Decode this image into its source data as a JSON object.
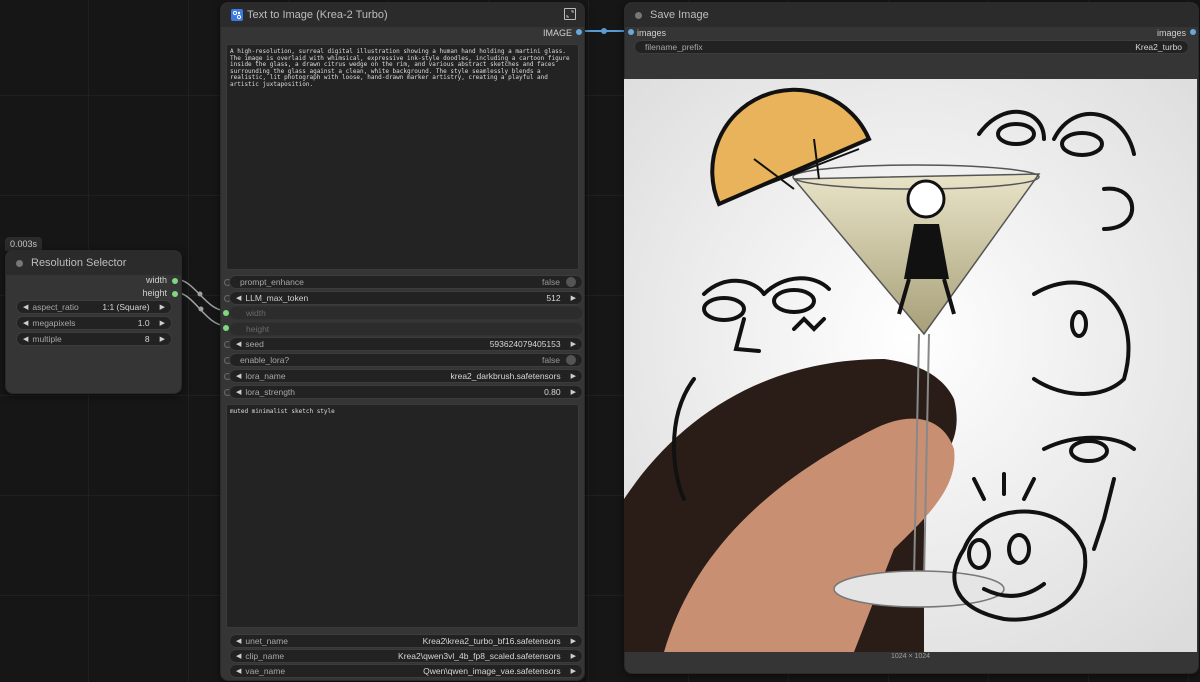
{
  "resolution_node": {
    "timing": "0.003s",
    "title": "Resolution Selector",
    "outputs": [
      "width",
      "height"
    ],
    "widgets": [
      {
        "label": "aspect_ratio",
        "value": "1:1 (Square)"
      },
      {
        "label": "megapixels",
        "value": "1.0"
      },
      {
        "label": "multiple",
        "value": "8"
      }
    ]
  },
  "t2i_node": {
    "title": "Text to Image (Krea-2 Turbo)",
    "output_label": "IMAGE",
    "prompt_text": "A high-resolution, surreal digital illustration showing a human hand holding a martini glass. The image is overlaid with whimsical, expressive ink-style doodles, including a cartoon figure inside the glass, a drawn citrus wedge on the rim, and various abstract sketches and faces surrounding the glass against a clean, white background. The style seamlessly blends a realistic, lit photograph with loose, hand-drawn marker artistry, creating a playful and artistic juxtaposition.",
    "widgets": [
      {
        "label": "prompt_enhance",
        "value": "false"
      },
      {
        "label": "LLM_max_token",
        "value": "512"
      },
      {
        "label": "width",
        "value": ""
      },
      {
        "label": "height",
        "value": ""
      },
      {
        "label": "seed",
        "value": "593624079405153"
      },
      {
        "label": "enable_lora?",
        "value": "false"
      },
      {
        "label": "lora_name",
        "value": "krea2_darkbrush.safetensors"
      },
      {
        "label": "lora_strength",
        "value": "0.80"
      }
    ],
    "style_text": "muted minimalist sketch style",
    "model_widgets": [
      {
        "label": "unet_name",
        "value": "Krea2\\krea2_turbo_bf16.safetensors"
      },
      {
        "label": "clip_name",
        "value": "Krea2\\qwen3vl_4b_fp8_scaled.safetensors"
      },
      {
        "label": "vae_name",
        "value": "Qwen\\qwen_image_vae.safetensors"
      }
    ]
  },
  "save_node": {
    "title": "Save Image",
    "input_label": "images",
    "output_label": "images",
    "filename_label": "filename_prefix",
    "filename_value": "Krea2_turbo",
    "caption": "1024 × 1024"
  },
  "colors": {
    "link": "#5b9bd5",
    "accent_green": "#7fd77f",
    "node_bg": "#353535"
  }
}
